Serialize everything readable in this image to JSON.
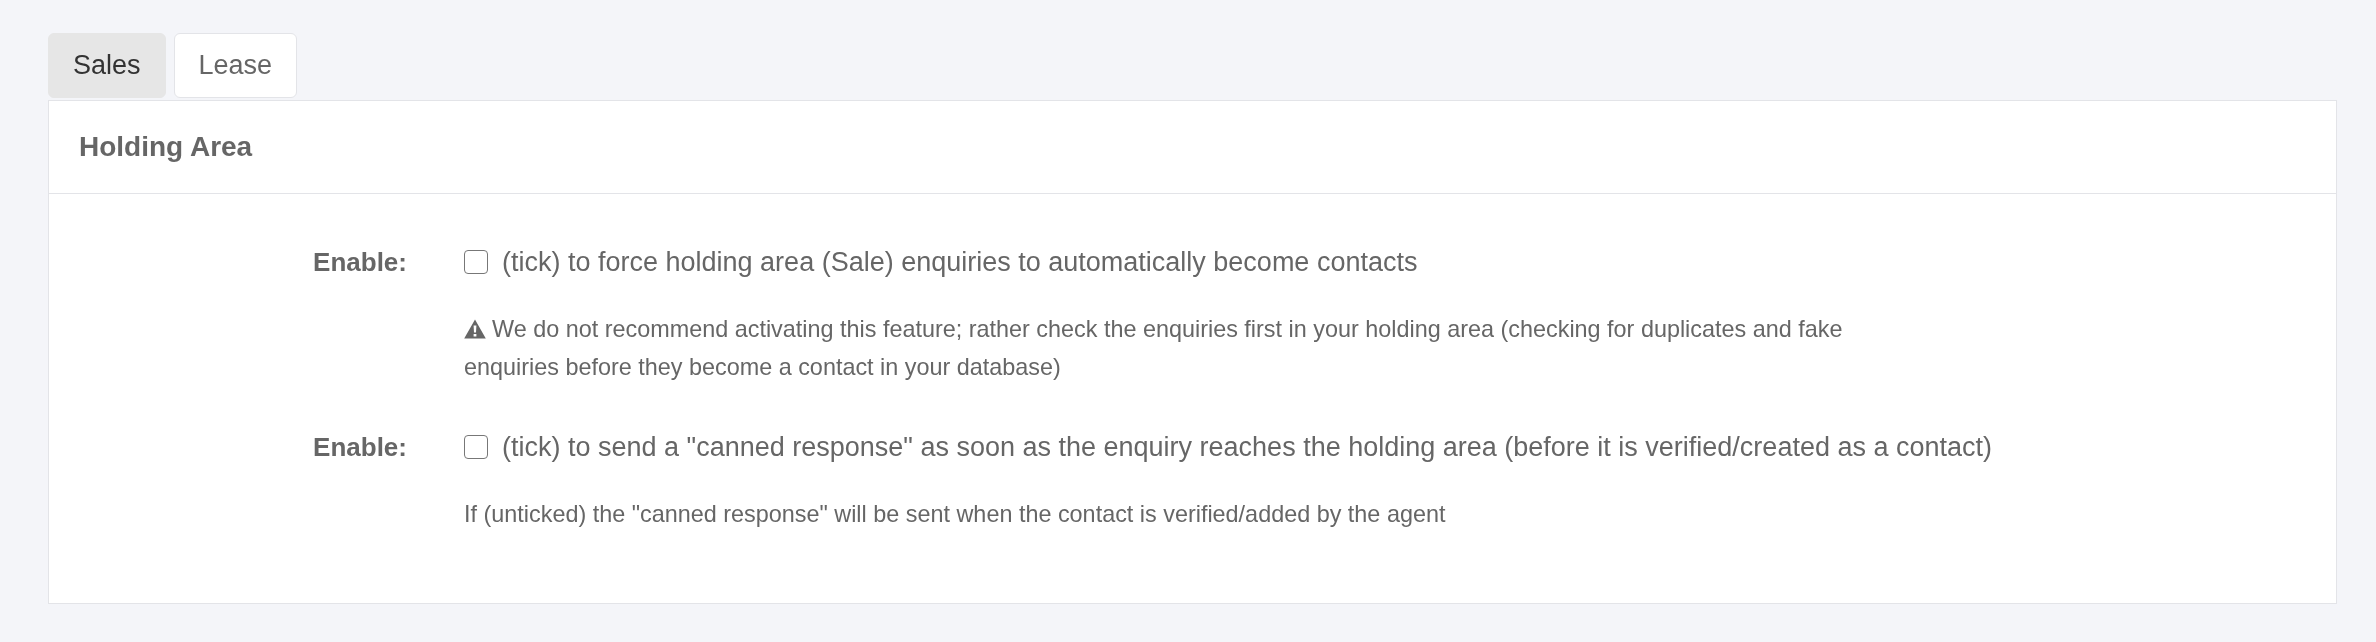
{
  "tabs": [
    {
      "label": "Sales",
      "selected": true
    },
    {
      "label": "Lease",
      "selected": false
    }
  ],
  "panel": {
    "title": "Holding Area",
    "settings": [
      {
        "label": "Enable:",
        "checked": false,
        "text": "(tick) to force holding area (Sale) enquiries to automatically become contacts",
        "note": {
          "kind": "warning",
          "text": "We do not recommend activating this feature; rather check the enquiries first in your holding area (checking for duplicates and fake enquiries before they become a contact in your database)"
        }
      },
      {
        "label": "Enable:",
        "checked": false,
        "text": "(tick) to send a \"canned response\" as soon as the enquiry reaches the holding area (before it is verified/created as a contact)",
        "note": {
          "kind": "plain",
          "text": "If (unticked) the \"canned response\" will be sent when the contact is verified/added by the agent"
        }
      }
    ]
  }
}
